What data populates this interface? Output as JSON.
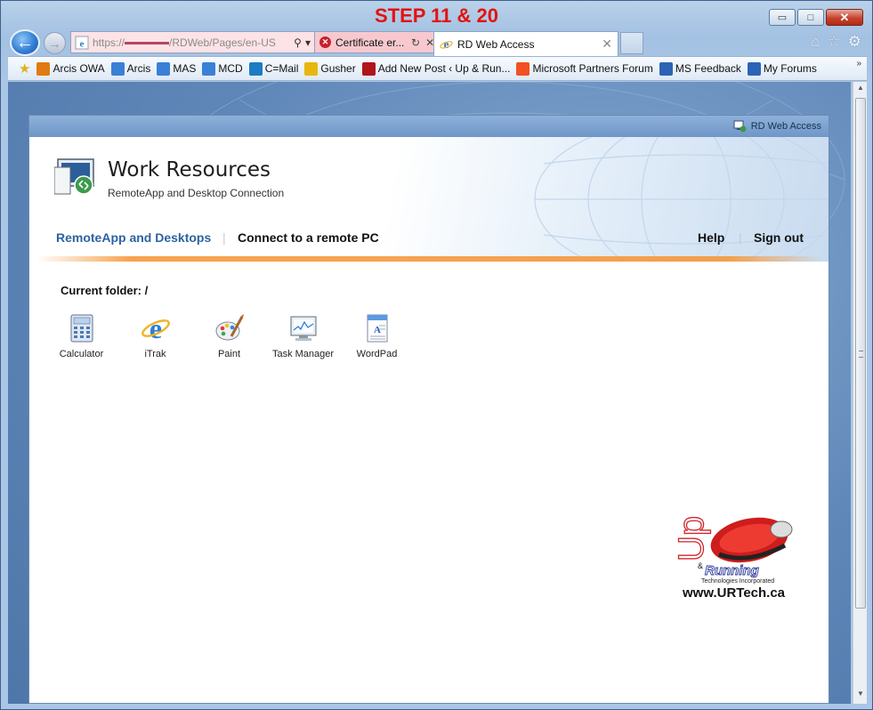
{
  "overlay": {
    "step_title": "STEP 11 & 20"
  },
  "window": {
    "minimize": "▭",
    "maximize": "□",
    "close": "✕"
  },
  "address": {
    "prefix": "https://",
    "suffix": "/RDWeb/Pages/en-US",
    "search_icon": "⚲",
    "dropdown_icon": "▾",
    "cert_label": "Certificate er...",
    "refresh_icon": "↻",
    "stop_icon": "✕"
  },
  "tab": {
    "label": "RD Web Access",
    "close": "✕"
  },
  "nav_tools": {
    "home": "⌂",
    "favorites": "☆",
    "settings": "⚙"
  },
  "favorites": [
    {
      "label": "Arcis OWA",
      "icon": "owa-icon",
      "color": "#e07a12"
    },
    {
      "label": "Arcis",
      "icon": "ie-page-icon",
      "color": "#3a80d6"
    },
    {
      "label": "MAS",
      "icon": "ie-page-icon",
      "color": "#3a80d6"
    },
    {
      "label": "MCD",
      "icon": "ie-page-icon",
      "color": "#3a80d6"
    },
    {
      "label": "C=Mail",
      "icon": "mail-icon",
      "color": "#1d7bc2"
    },
    {
      "label": "Gusher",
      "icon": "smiley-icon",
      "color": "#e8b70f"
    },
    {
      "label": "Add New Post ‹ Up & Run...",
      "icon": "mouse-icon",
      "color": "#b0151b"
    },
    {
      "label": "Microsoft Partners Forum",
      "icon": "windows-icon",
      "color": "#f25022"
    },
    {
      "label": "MS Feedback",
      "icon": "ms-icon",
      "color": "#2b64b5"
    },
    {
      "label": "My Forums",
      "icon": "ms-icon",
      "color": "#2b64b5"
    }
  ],
  "fav_more": "»",
  "rdweb": {
    "top_title": "RD Web Access",
    "title": "Work Resources",
    "subtitle": "RemoteApp and Desktop Connection",
    "nav_remoteapp": "RemoteApp and Desktops",
    "nav_separator": "|",
    "nav_connect": "Connect to a remote PC",
    "help": "Help",
    "sign_out": "Sign out",
    "current_folder": "Current folder: /",
    "apps": [
      {
        "label": "Calculator",
        "icon": "calculator-icon"
      },
      {
        "label": "iTrak",
        "icon": "ie-icon"
      },
      {
        "label": "Paint",
        "icon": "paint-icon"
      },
      {
        "label": "Task Manager",
        "icon": "task-manager-icon"
      },
      {
        "label": "WordPad",
        "icon": "wordpad-icon"
      }
    ]
  },
  "logo": {
    "up": "Up",
    "amp": "&",
    "running": "Running",
    "tagline": "Technologies Incorporated",
    "url": "www.URTech.ca"
  },
  "colors": {
    "step_title": "#e3130f",
    "nav_active": "#2d62a2",
    "orange_rule": "#f6983a",
    "cert_error_bg": "#f7c9cf"
  }
}
